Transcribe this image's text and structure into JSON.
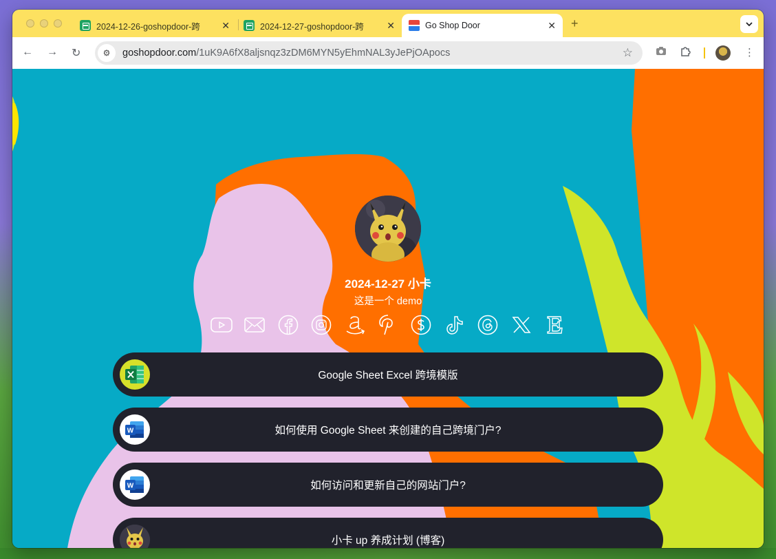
{
  "browser": {
    "tabs": [
      {
        "title": "2024-12-26-goshopdoor-跨",
        "active": false,
        "favicon": "google-sheets-icon"
      },
      {
        "title": "2024-12-27-goshopdoor-跨",
        "active": false,
        "favicon": "google-sheets-icon"
      },
      {
        "title": "Go Shop Door",
        "active": true,
        "favicon": "store-icon"
      }
    ],
    "url_domain": "goshopdoor.com",
    "url_path": "/1uK9A6fX8aljsnqz3zDM6MYN5yEhmNAL3yJePjOApocs"
  },
  "profile": {
    "name": "2024-12-27 小卡",
    "bio": "这是一个 demo"
  },
  "socials": [
    {
      "name": "youtube-icon"
    },
    {
      "name": "email-icon"
    },
    {
      "name": "facebook-icon"
    },
    {
      "name": "instagram-icon"
    },
    {
      "name": "amazon-icon"
    },
    {
      "name": "pinterest-icon"
    },
    {
      "name": "cashapp-icon"
    },
    {
      "name": "tiktok-icon"
    },
    {
      "name": "threads-icon"
    },
    {
      "name": "x-icon"
    },
    {
      "name": "etsy-icon"
    }
  ],
  "links": [
    {
      "label": "Google Sheet Excel 跨境模版",
      "icon": "excel-icon"
    },
    {
      "label": "如何使用 Google Sheet 来创建的自己跨境门户?",
      "icon": "word-icon"
    },
    {
      "label": "如何访问和更新自己的网站门户?",
      "icon": "word-icon"
    },
    {
      "label": "小卡 up 养成计划 (博客)",
      "icon": "pikachu-avatar"
    }
  ],
  "colors": {
    "tabstrip": "#fde160",
    "page_bg": "#06aac6",
    "orange": "#ff6f00",
    "pink": "#e9c3e9",
    "lime": "#cfe52a",
    "link_bg": "#21222c"
  }
}
